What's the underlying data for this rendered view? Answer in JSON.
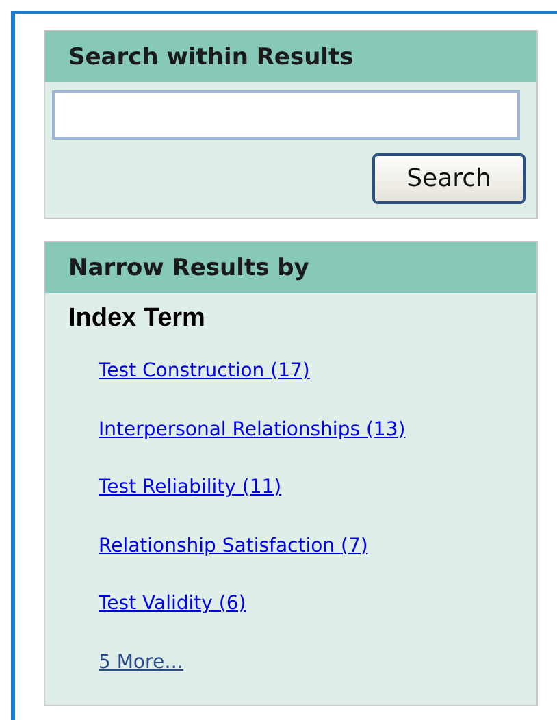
{
  "search_panel": {
    "title": "Search within Results",
    "search_button": "Search"
  },
  "narrow_panel": {
    "title": "Narrow Results by",
    "section": "Index Term",
    "links": [
      {
        "label": "Test Construction (17)",
        "visited": false
      },
      {
        "label": "Interpersonal Relationships (13)",
        "visited": false
      },
      {
        "label": "Test Reliability (11)",
        "visited": false
      },
      {
        "label": "Relationship Satisfaction (7)",
        "visited": false
      },
      {
        "label": "Test Validity (6)",
        "visited": false
      },
      {
        "label": "5 More…",
        "visited": true
      }
    ]
  }
}
